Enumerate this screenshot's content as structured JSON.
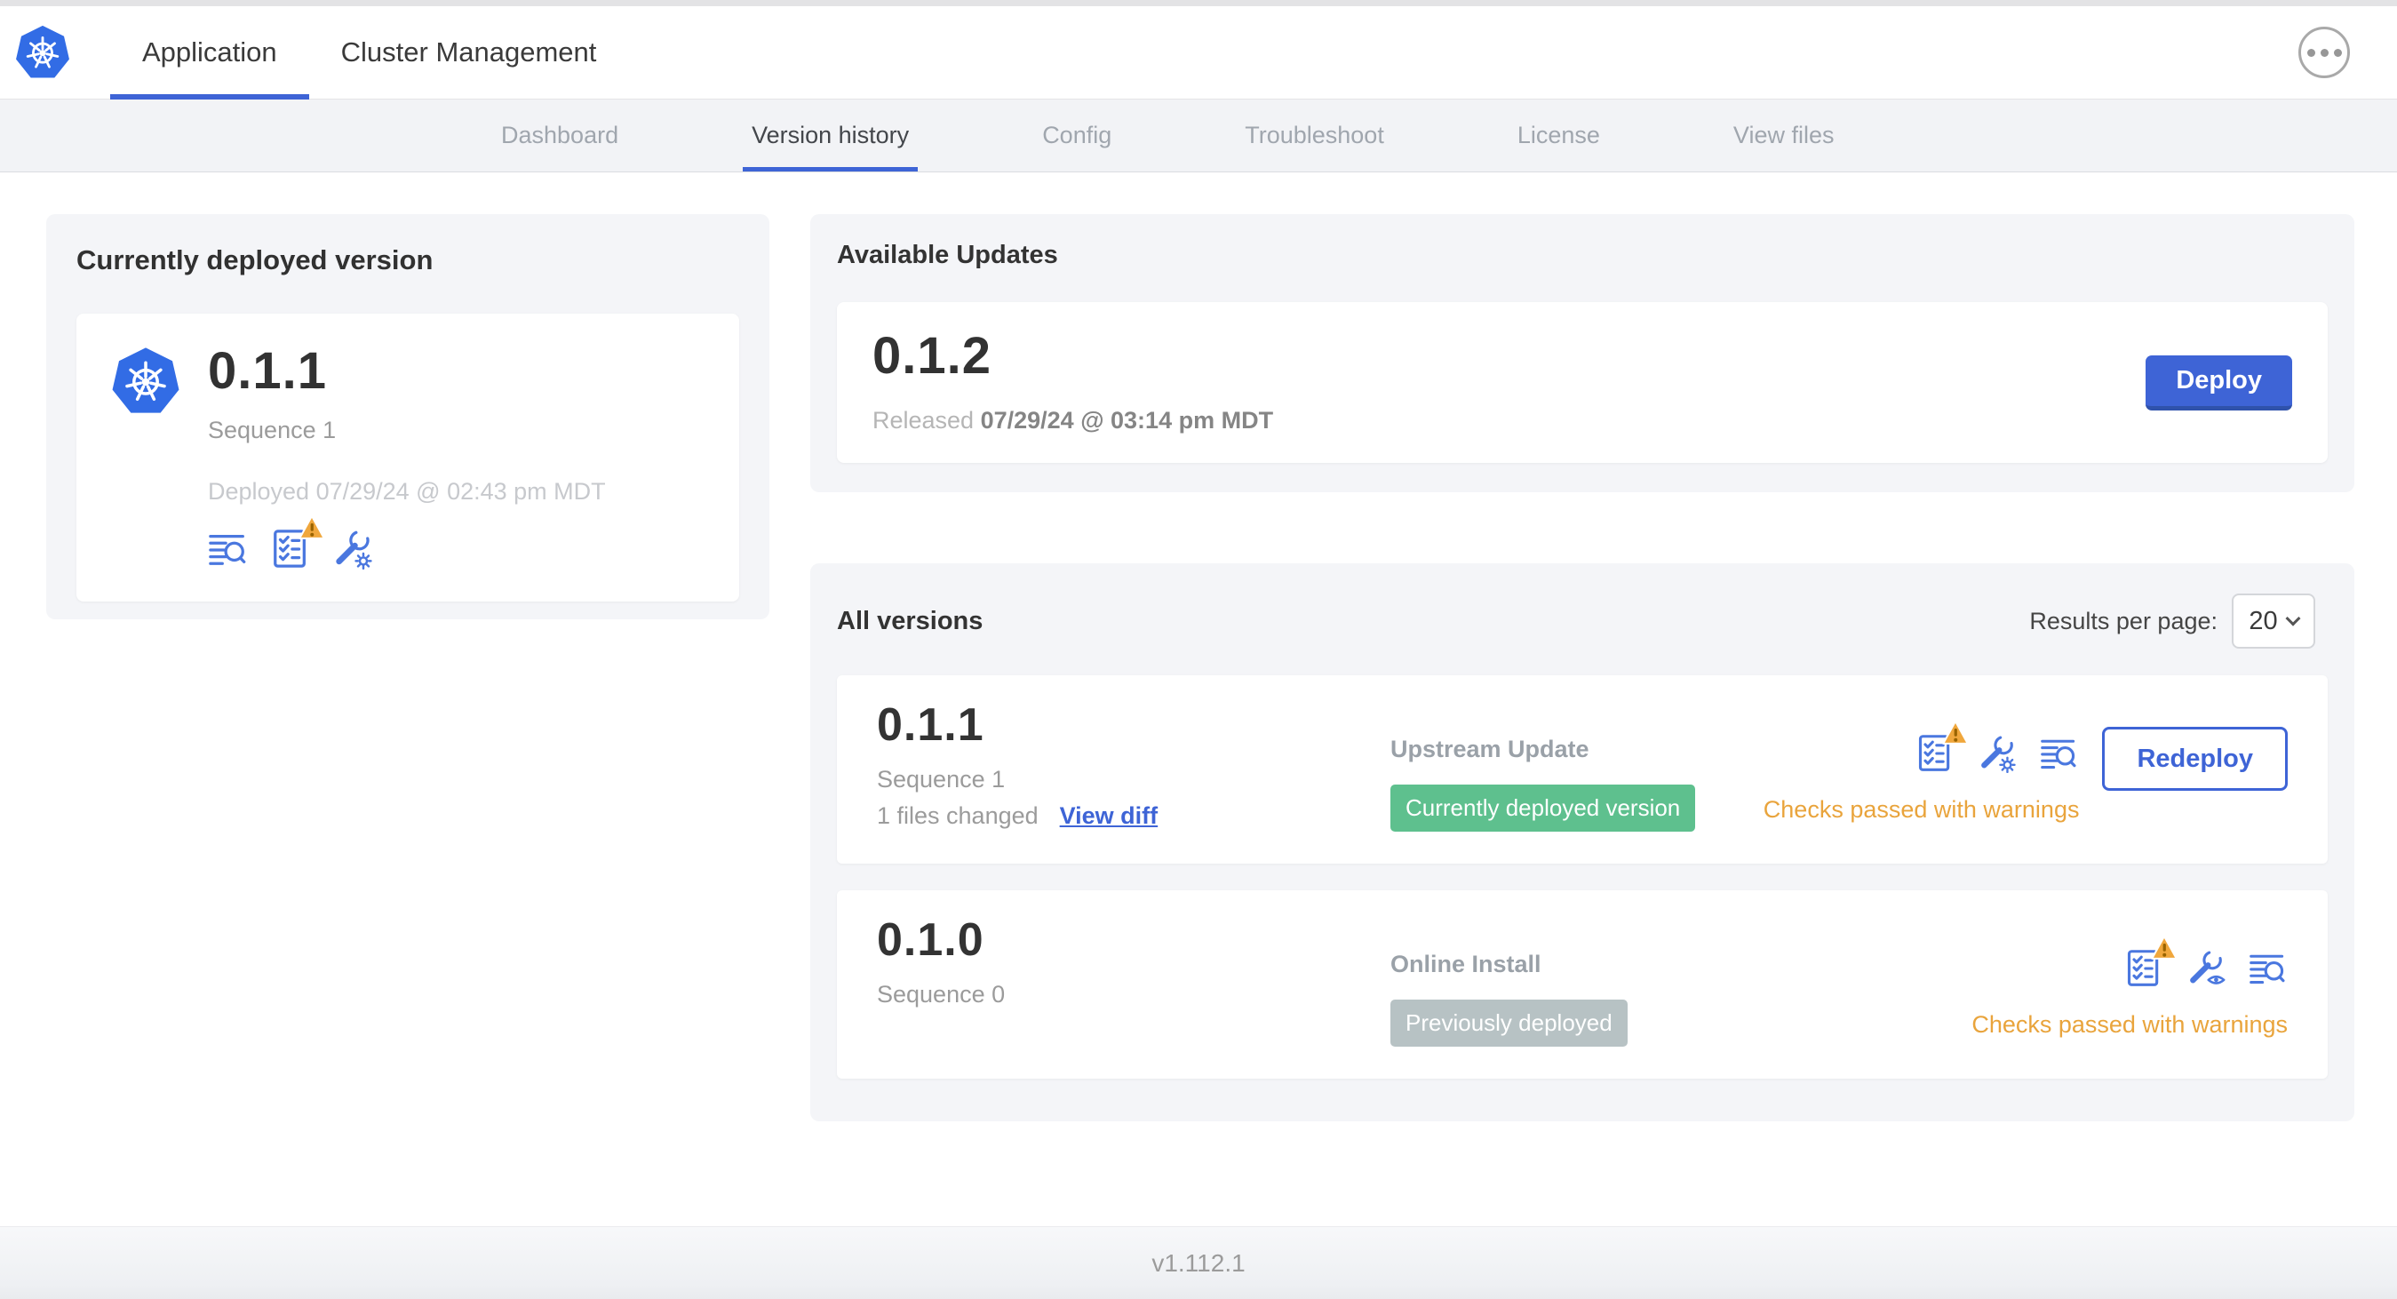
{
  "header": {
    "tabs": [
      {
        "label": "Application",
        "active": true
      },
      {
        "label": "Cluster Management",
        "active": false
      }
    ]
  },
  "subnav": {
    "tabs": [
      {
        "label": "Dashboard",
        "active": false
      },
      {
        "label": "Version history",
        "active": true
      },
      {
        "label": "Config",
        "active": false
      },
      {
        "label": "Troubleshoot",
        "active": false
      },
      {
        "label": "License",
        "active": false
      },
      {
        "label": "View files",
        "active": false
      }
    ]
  },
  "currently_deployed": {
    "title": "Currently deployed version",
    "version": "0.1.1",
    "sequence": "Sequence 1",
    "deployed_at": "Deployed 07/29/24 @ 02:43 pm MDT"
  },
  "available_updates": {
    "title": "Available Updates",
    "version": "0.1.2",
    "released_prefix": "Released",
    "released_date": "07/29/24 @ 03:14 pm MDT",
    "deploy_label": "Deploy"
  },
  "all_versions": {
    "title": "All versions",
    "results_per_page_label": "Results per page:",
    "results_per_page_value": "20",
    "rows": [
      {
        "version": "0.1.1",
        "sequence": "Sequence 1",
        "files_changed": "1 files changed",
        "view_diff_label": "View diff",
        "source": "Upstream Update",
        "badge": "Currently deployed version",
        "action_label": "Redeploy",
        "checks": "Checks passed with warnings"
      },
      {
        "version": "0.1.0",
        "sequence": "Sequence 0",
        "source": "Online Install",
        "badge": "Previously deployed",
        "checks": "Checks passed with warnings"
      }
    ]
  },
  "footer": {
    "version": "v1.112.1"
  },
  "icons": {
    "logo": "kubernetes-logo-icon",
    "more": "ellipsis-icon",
    "logs": "diff-lines-magnifier-icon",
    "preflight": "checklist-warning-icon",
    "config_edit": "wrench-gear-icon",
    "config_view": "wrench-eye-icon",
    "select_chevron": "chevron-down-icon"
  },
  "colors": {
    "primary_blue": "#3E64D6",
    "icon_blue": "#4A77DF",
    "green_badge": "#5EC08E",
    "gray_badge": "#B7C2C4",
    "warning_orange": "#E9A43C",
    "warning_triangle": "#F0A73C"
  }
}
